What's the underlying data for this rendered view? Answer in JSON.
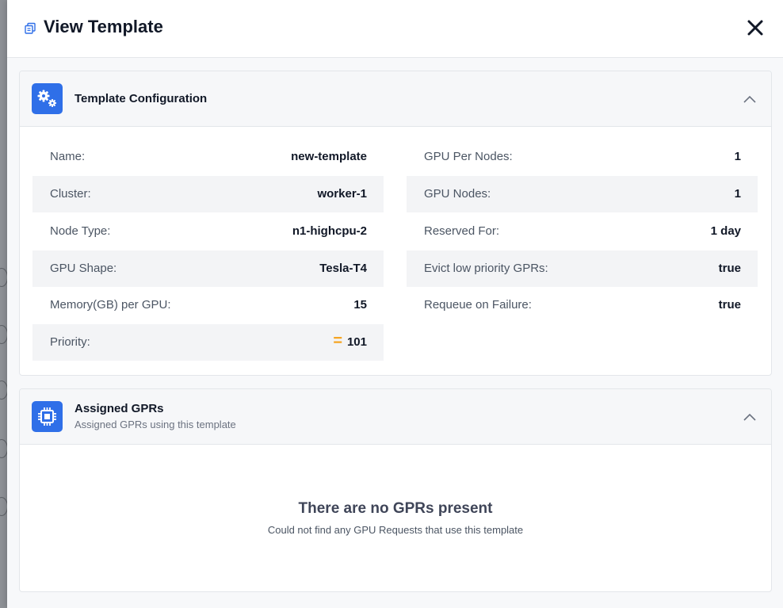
{
  "header": {
    "title": "View Template",
    "icon": "copy-icon",
    "close_icon": "close-icon"
  },
  "config_card": {
    "title": "Template Configuration",
    "icon": "gears-icon",
    "left": [
      {
        "label": "Name:",
        "value": "new-template"
      },
      {
        "label": "Cluster:",
        "value": "worker-1"
      },
      {
        "label": "Node Type:",
        "value": "n1-highcpu-2"
      },
      {
        "label": "GPU Shape:",
        "value": "Tesla-T4"
      },
      {
        "label": "Memory(GB) per GPU:",
        "value": "15"
      },
      {
        "label": "Priority:",
        "value": "101",
        "badge": "="
      }
    ],
    "right": [
      {
        "label": "GPU Per Nodes:",
        "value": "1"
      },
      {
        "label": "GPU Nodes:",
        "value": "1"
      },
      {
        "label": "Reserved For:",
        "value": "1 day"
      },
      {
        "label": "Evict low priority GPRs:",
        "value": "true"
      },
      {
        "label": "Requeue on Failure:",
        "value": "true"
      }
    ]
  },
  "gprs_card": {
    "title": "Assigned GPRs",
    "subtitle": "Assigned GPRs using this template",
    "icon": "chip-icon",
    "empty_title": "There are no GPRs present",
    "empty_subtitle": "Could not find any GPU Requests that use this template"
  },
  "colors": {
    "accent": "#2f6fe8",
    "priority": "#f5a524"
  }
}
